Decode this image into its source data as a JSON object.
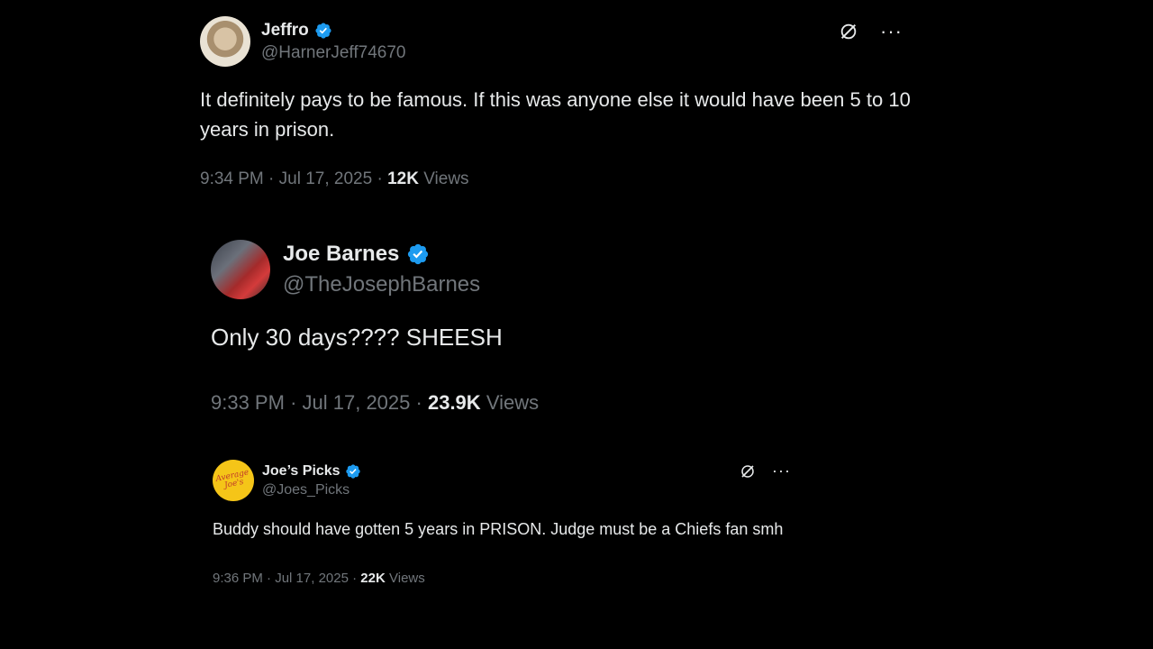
{
  "tweets": [
    {
      "display_name": "Jeffro",
      "handle": "@HarnerJeff74670",
      "verified_icon": "verified-badge-icon",
      "text": "It definitely pays to be famous. If this was anyone else it would have been 5 to 10 years in prison.",
      "time": "9:34 PM",
      "sep1": "·",
      "date": "Jul 17, 2025",
      "sep2": "·",
      "views_count": "12K",
      "views_label": "Views",
      "actions": {
        "grok_icon": "grok-icon",
        "more": "···"
      }
    },
    {
      "display_name": "Joe Barnes",
      "handle": "@TheJosephBarnes",
      "verified_icon": "verified-badge-icon",
      "text": "Only 30 days???? SHEESH",
      "time": "9:33 PM",
      "sep1": "·",
      "date": "Jul 17, 2025",
      "sep2": "·",
      "views_count": "23.9K",
      "views_label": "Views"
    },
    {
      "display_name": "Joe’s Picks",
      "handle": "@Joes_Picks",
      "verified_icon": "verified-badge-icon",
      "text": "Buddy should have gotten 5 years in PRISON. Judge must be a Chiefs fan smh",
      "time": "9:36 PM",
      "sep1": "·",
      "date": "Jul 17, 2025",
      "sep2": "·",
      "views_count": "22K",
      "views_label": "Views",
      "actions": {
        "grok_icon": "grok-icon",
        "more": "···"
      },
      "avatar_logo_text": "Average Joe's"
    }
  ],
  "colors": {
    "background": "#000000",
    "text": "#e7e9ea",
    "secondary": "#71767b",
    "verified": "#1d9bf0"
  }
}
